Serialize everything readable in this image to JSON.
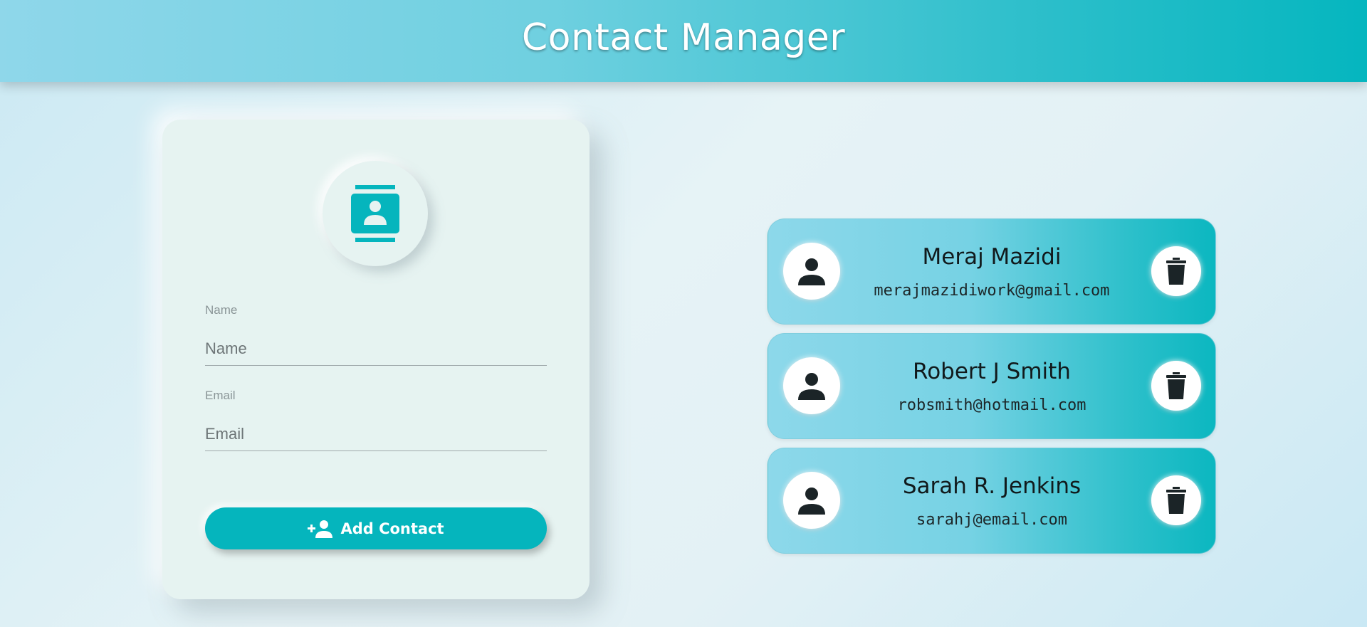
{
  "header": {
    "title": "Contact Manager"
  },
  "form": {
    "name_label": "Name",
    "name_placeholder": "Name",
    "name_value": "",
    "email_label": "Email",
    "email_placeholder": "Email",
    "email_value": "",
    "add_button_label": "Add Contact",
    "add_button_icon": "person-add-icon",
    "avatar_icon": "contact-book-icon"
  },
  "contacts": [
    {
      "name": "Meraj Mazidi",
      "email": "merajmazidiwork@gmail.com",
      "avatar_icon": "person-icon",
      "delete_icon": "trash-icon"
    },
    {
      "name": "Robert J Smith",
      "email": "robsmith@hotmail.com",
      "avatar_icon": "person-icon",
      "delete_icon": "trash-icon"
    },
    {
      "name": "Sarah R. Jenkins",
      "email": "sarahj@email.com",
      "avatar_icon": "person-icon",
      "delete_icon": "trash-icon"
    }
  ],
  "colors": {
    "accent": "#05b5bd",
    "header_start": "#8fd7ea",
    "header_end": "#05b6bf",
    "card_bg": "#e6f3f1"
  }
}
